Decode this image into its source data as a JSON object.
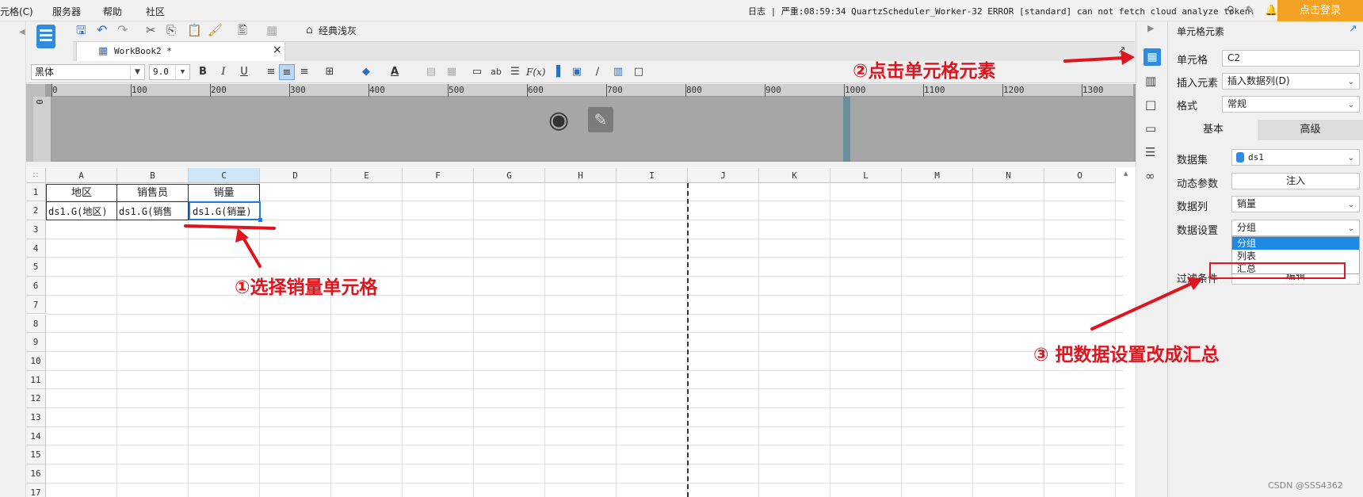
{
  "menubar": {
    "items": [
      "元格(C)",
      "服务器",
      "帮助",
      "社区"
    ],
    "log": "日志 | 严重:08:59:34 QuartzScheduler_Worker-32 ERROR [standard] can not fetch cloud analyze token.",
    "login": "点击登录"
  },
  "toolbar": {
    "theme_button": "经典浅灰",
    "tab_label": "WorkBook2 *",
    "tab_close": "×",
    "font_name": "黑体",
    "font_size": "9.0"
  },
  "ruler": {
    "ticks": [
      "0",
      "100",
      "200",
      "300",
      "400",
      "500",
      "600",
      "700",
      "800",
      "900",
      "1000",
      "1100",
      "1200",
      "1300"
    ],
    "vtick": "0"
  },
  "grid": {
    "columns": [
      "A",
      "B",
      "C",
      "D",
      "E",
      "F",
      "G",
      "H",
      "I",
      "J",
      "K",
      "L",
      "M",
      "N",
      "O"
    ],
    "rows": [
      "1",
      "2",
      "3",
      "4",
      "5",
      "6",
      "7",
      "8",
      "9",
      "10",
      "11",
      "12",
      "13",
      "14",
      "15",
      "16",
      "17"
    ],
    "row1": [
      "地区",
      "销售员",
      "销量"
    ],
    "row2": [
      "ds1.G(地区)",
      "ds1.G(销售",
      "ds1.G(销量)"
    ]
  },
  "panel": {
    "title": "单元格元素",
    "cell_label": "单元格",
    "cell_value": "C2",
    "insert_label": "插入元素",
    "insert_value": "插入数据列(D)",
    "format_label": "格式",
    "format_value": "常规",
    "tab_basic": "基本",
    "tab_advanced": "高级",
    "dataset_label": "数据集",
    "dataset_value": "ds1",
    "param_label": "动态参数",
    "param_button": "注入",
    "column_label": "数据列",
    "column_value": "销量",
    "setting_label": "数据设置",
    "setting_value": "分组",
    "dropdown_options": [
      "分组",
      "列表",
      "汇总"
    ],
    "filter_label": "过滤条件",
    "filter_partial": "编辑"
  },
  "annotations": {
    "step1": "①选择销量单元格",
    "step2": "②点击单元格元素",
    "step3": "③ 把数据设置改成汇总"
  },
  "watermark": "CSDN @SSS4362",
  "colors": {
    "annotation": "#e0141e",
    "login_bg": "#f4a224",
    "selection": "#1f7de0",
    "dropdown_sel": "#1e88e5"
  }
}
